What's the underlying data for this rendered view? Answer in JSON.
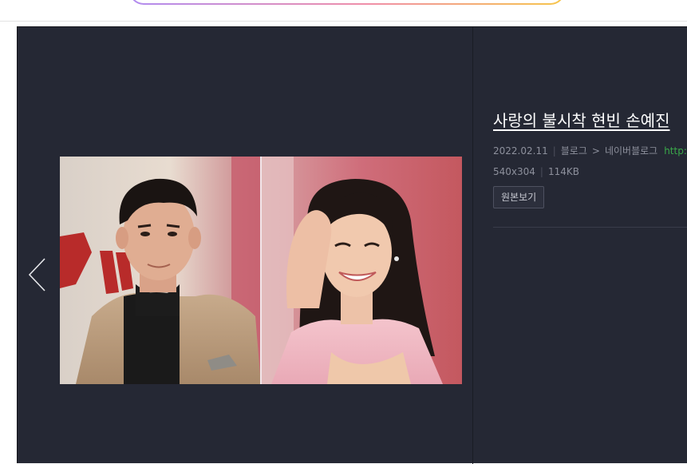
{
  "viewer": {
    "title": "사랑의 불시착 현빈 손예진",
    "date": "2022.02.11",
    "category": "블로그",
    "arrow": ">",
    "source": "네이버블로그",
    "url": "http://b",
    "dimensions": "540x304",
    "size": "114KB",
    "original_button": "원본보기"
  },
  "colors": {
    "background": "#252834",
    "link": "#3aa84a",
    "meta_text": "#8d909c"
  },
  "icons": {
    "prev": "chevron-left-icon"
  }
}
